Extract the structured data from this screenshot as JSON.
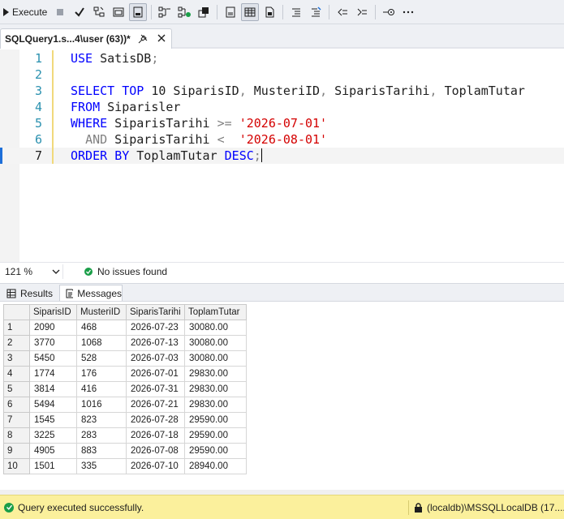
{
  "toolbar": {
    "execute_label": "Execute"
  },
  "tab": {
    "title": "SQLQuery1.s...4\\user (63))*"
  },
  "editor": {
    "lines": [
      {
        "n": "1",
        "tokens": [
          {
            "t": "USE",
            "c": "kw"
          },
          {
            "t": " SatisDB",
            "c": ""
          },
          {
            "t": ";",
            "c": "gr"
          }
        ]
      },
      {
        "n": "2",
        "tokens": []
      },
      {
        "n": "3",
        "tokens": [
          {
            "t": "SELECT",
            "c": "kw"
          },
          {
            "t": " ",
            "c": ""
          },
          {
            "t": "TOP",
            "c": "kw"
          },
          {
            "t": " 10 SiparisID",
            "c": ""
          },
          {
            "t": ",",
            "c": "gr"
          },
          {
            "t": " MusteriID",
            "c": ""
          },
          {
            "t": ",",
            "c": "gr"
          },
          {
            "t": " SiparisTarihi",
            "c": ""
          },
          {
            "t": ",",
            "c": "gr"
          },
          {
            "t": " ToplamTutar",
            "c": ""
          }
        ]
      },
      {
        "n": "4",
        "tokens": [
          {
            "t": "FROM",
            "c": "kw"
          },
          {
            "t": " Siparisler",
            "c": ""
          }
        ]
      },
      {
        "n": "5",
        "tokens": [
          {
            "t": "WHERE",
            "c": "kw"
          },
          {
            "t": " SiparisTarihi ",
            "c": ""
          },
          {
            "t": ">=",
            "c": "gr"
          },
          {
            "t": " ",
            "c": ""
          },
          {
            "t": "'2026-07-01'",
            "c": "str"
          }
        ]
      },
      {
        "n": "6",
        "tokens": [
          {
            "t": "  ",
            "c": ""
          },
          {
            "t": "AND",
            "c": "gr"
          },
          {
            "t": " SiparisTarihi ",
            "c": ""
          },
          {
            "t": "<",
            "c": "gr"
          },
          {
            "t": "  ",
            "c": ""
          },
          {
            "t": "'2026-08-01'",
            "c": "str"
          }
        ]
      },
      {
        "n": "7",
        "tokens": [
          {
            "t": "ORDER",
            "c": "kw"
          },
          {
            "t": " ",
            "c": ""
          },
          {
            "t": "BY",
            "c": "kw"
          },
          {
            "t": " ToplamTutar ",
            "c": ""
          },
          {
            "t": "DESC",
            "c": "kw"
          },
          {
            "t": ";",
            "c": "gr"
          }
        ]
      }
    ],
    "current_line": 7
  },
  "status": {
    "zoom": "121 %",
    "issues": "No issues found"
  },
  "results_tabs": {
    "results": "Results",
    "messages": "Messages"
  },
  "grid": {
    "columns": [
      "SiparisID",
      "MusteriID",
      "SiparisTarihi",
      "ToplamTutar"
    ],
    "rows": [
      {
        "n": "1",
        "cells": [
          "2090",
          "468",
          "2026-07-23",
          "30080.00"
        ]
      },
      {
        "n": "2",
        "cells": [
          "3770",
          "1068",
          "2026-07-13",
          "30080.00"
        ]
      },
      {
        "n": "3",
        "cells": [
          "5450",
          "528",
          "2026-07-03",
          "30080.00"
        ]
      },
      {
        "n": "4",
        "cells": [
          "1774",
          "176",
          "2026-07-01",
          "29830.00"
        ]
      },
      {
        "n": "5",
        "cells": [
          "3814",
          "416",
          "2026-07-31",
          "29830.00"
        ]
      },
      {
        "n": "6",
        "cells": [
          "5494",
          "1016",
          "2026-07-21",
          "29830.00"
        ]
      },
      {
        "n": "7",
        "cells": [
          "1545",
          "823",
          "2026-07-28",
          "29590.00"
        ]
      },
      {
        "n": "8",
        "cells": [
          "3225",
          "283",
          "2026-07-18",
          "29590.00"
        ]
      },
      {
        "n": "9",
        "cells": [
          "4905",
          "883",
          "2026-07-08",
          "29590.00"
        ]
      },
      {
        "n": "10",
        "cells": [
          "1501",
          "335",
          "2026-07-10",
          "28940.00"
        ]
      }
    ]
  },
  "statusbar": {
    "message": "Query executed successfully.",
    "server": "(localdb)\\MSSQLLocalDB (17...."
  }
}
